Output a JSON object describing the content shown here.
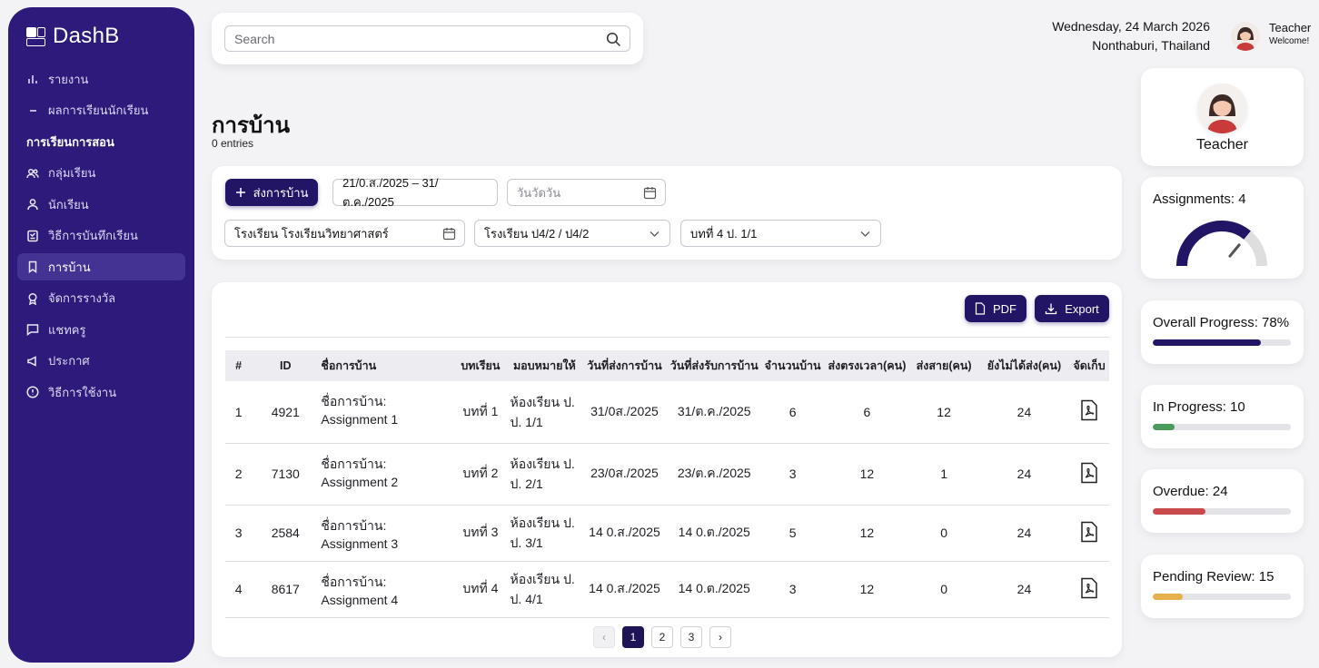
{
  "sidebar": {
    "brand": "DashB",
    "items": [
      {
        "label": "รายงาน",
        "icon": "bar-chart-icon"
      },
      {
        "label": "ผลการเรียนนักเรียน",
        "icon": "dash-icon"
      },
      {
        "label": "การเรียนการสอน",
        "icon": ""
      },
      {
        "label": "กลุ่มเรียน",
        "icon": "users-icon"
      },
      {
        "label": "นักเรียน",
        "icon": "user-icon"
      },
      {
        "label": "วิธีการบันทึกเรียน",
        "icon": "document-icon"
      },
      {
        "label": "การบ้าน",
        "icon": "bookmark-icon"
      },
      {
        "label": "จัดการรางวัล",
        "icon": "award-icon"
      },
      {
        "label": "แชทครู",
        "icon": "chat-icon"
      },
      {
        "label": "ประกาศ",
        "icon": "megaphone-icon"
      },
      {
        "label": "วิธีการใช้งาน",
        "icon": "info-icon"
      }
    ]
  },
  "search": {
    "placeholder": "Search"
  },
  "header": {
    "date": "Wednesday, 24 March 2026",
    "location": "Nonthaburi, Thailand",
    "user_name": "Teacher",
    "user_greeting": "Welcome!"
  },
  "page": {
    "title": "การบ้าน",
    "entries": "0 entries"
  },
  "filters": {
    "add_button": "ส่งการบ้าน",
    "date_range": "21/0.ส./2025 – 31/ต.ค./2025",
    "due_date_placeholder": "วันวัดวัน",
    "school": "โรงเรียน โรงเรียนวิทยาศาสตร์",
    "class": "โรงเรียน ป4/2 / ป4/2",
    "lesson": "บทที่ 4 ป. 1/1"
  },
  "table": {
    "pdf_button": "PDF",
    "export_button": "Export",
    "columns": [
      "#",
      "ID",
      "ชื่อการบ้าน",
      "บทเรียน",
      "มอบหมายให้",
      "วันที่ส่งการบ้าน",
      "วันที่ส่งรับการบ้าน",
      "จำนวนบ้าน",
      "ส่งตรงเวลา(คน)",
      "ส่งสาย(คน)",
      "ยังไม่ได้ส่ง(คน)",
      "จัดเก็บ"
    ],
    "rows": [
      {
        "n": "1",
        "id": "4921",
        "name": "ชื่อการบ้าน: Assignment 1",
        "lesson": "บทที่ 1",
        "room": "ห้องเรียน ป. ป. 1/1",
        "assigned": "31/0ส./2025",
        "due": "31/ต.ค./2025",
        "count": "6",
        "ontime": "6",
        "late": "12",
        "missing": "24"
      },
      {
        "n": "2",
        "id": "7130",
        "name": "ชื่อการบ้าน: Assignment 2",
        "lesson": "บทที่ 2",
        "room": "ห้องเรียน ป. ป. 2/1",
        "assigned": "23/0ส./2025",
        "due": "23/ต.ค./2025",
        "count": "3",
        "ontime": "12",
        "late": "1",
        "missing": "24"
      },
      {
        "n": "3",
        "id": "2584",
        "name": "ชื่อการบ้าน: Assignment 3",
        "lesson": "บทที่ 3",
        "room": "ห้องเรียน ป. ป. 3/1",
        "assigned": "14 0.ส./2025",
        "due": "14 0.ต./2025",
        "count": "5",
        "ontime": "12",
        "late": "0",
        "missing": "24"
      },
      {
        "n": "4",
        "id": "8617",
        "name": "ชื่อการบ้าน: Assignment 4",
        "lesson": "บทที่ 4",
        "room": "ห้องเรียน ป. ป. 4/1",
        "assigned": "14 0.ส./2025",
        "due": "14 0.ต./2025",
        "count": "3",
        "ontime": "12",
        "late": "0",
        "missing": "24"
      }
    ]
  },
  "pagination": {
    "prev": "‹",
    "pages": [
      "1",
      "2",
      "3"
    ],
    "next": "›",
    "current": "1"
  },
  "stats": {
    "teacher_label": "Teacher",
    "assignments": "Assignments: 4",
    "overall": "Overall Progress: 78%",
    "in_progress": "In Progress: 10",
    "overdue": "Overdue: 24",
    "pending": "Pending Review: 15",
    "overall_fraction": 0.78,
    "in_progress_fraction": 0.16,
    "overdue_fraction": 0.38,
    "pending_fraction": 0.22,
    "gauge_fraction": 0.72,
    "colors": {
      "primary": "#231565",
      "overall": "#231565",
      "in_progress": "#4a9a5c",
      "overdue": "#c94a4a",
      "pending": "#e8b04a"
    }
  }
}
